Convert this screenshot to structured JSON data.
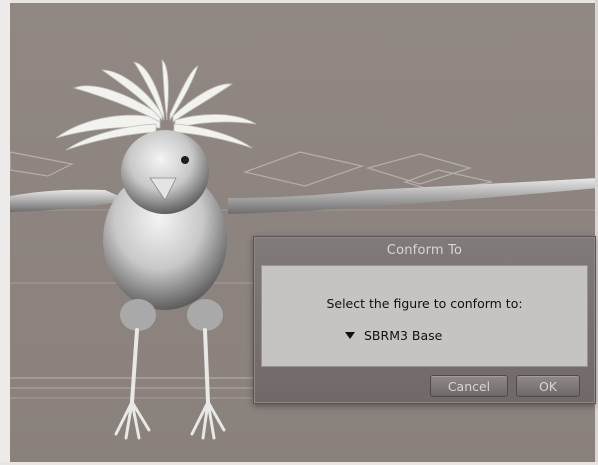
{
  "dialog": {
    "title": "Conform To",
    "prompt": "Select the figure to conform to:",
    "selected_figure": "SBRM3 Base",
    "cancel_label": "Cancel",
    "ok_label": "OK"
  },
  "icons": {
    "dropdown": "triangle-down-icon"
  },
  "colors": {
    "viewport_bg": "#8f8580",
    "dialog_bg": "#706967",
    "panel_bg": "#c6c4c3",
    "title_text": "#d9d6d4"
  }
}
